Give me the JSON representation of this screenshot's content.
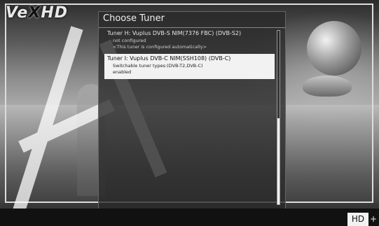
{
  "logo": {
    "prefix": "Ve",
    "x": "X",
    "suffix": "HD"
  },
  "dialog": {
    "title": "Choose Tuner",
    "entries": [
      {
        "name": "Tuner H: Vuplus DVB-S NIM(7376 FBC) (DVB-S2)",
        "line1": "not configured",
        "line2": "<This tuner is configured automatically>",
        "selected": false
      },
      {
        "name": "Tuner I: Vuplus DVB-C NIM(SSH108) (DVB-C)",
        "line1": "Switchable tuner types:(DVB-T2,DVB-C)",
        "line2": "enabled",
        "selected": true
      }
    ]
  },
  "status": {
    "hd_badge": "HD",
    "plus": "+"
  }
}
